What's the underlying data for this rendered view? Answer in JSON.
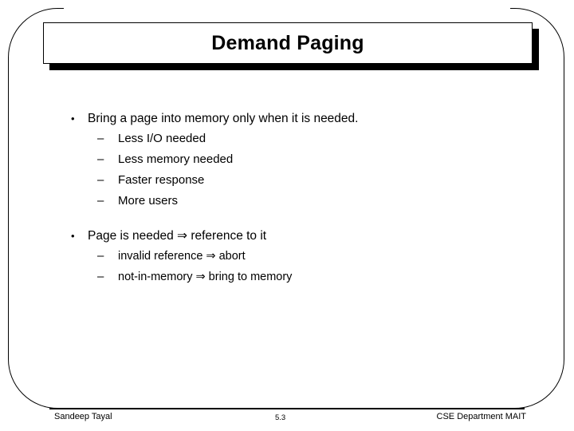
{
  "slide": {
    "title": "Demand Paging",
    "groups": [
      {
        "bullet_marker": "•",
        "bullet_text": "Bring a page into memory only when it is needed.",
        "sub_marker": "–",
        "sub_items": [
          "Less I/O needed",
          "Less memory needed",
          "Faster response",
          "More users"
        ]
      },
      {
        "bullet_marker": "•",
        "bullet_text": "Page is needed ⇒ reference to it",
        "sub_marker": "–",
        "sub_items": [
          "invalid reference ⇒ abort",
          "not-in-memory ⇒ bring to memory"
        ]
      }
    ]
  },
  "footer": {
    "author": "Sandeep Tayal",
    "page_number": "5.3",
    "department": "CSE Department MAIT"
  },
  "colors": {
    "text": "#000000",
    "background": "#ffffff",
    "shadow": "#000000"
  }
}
